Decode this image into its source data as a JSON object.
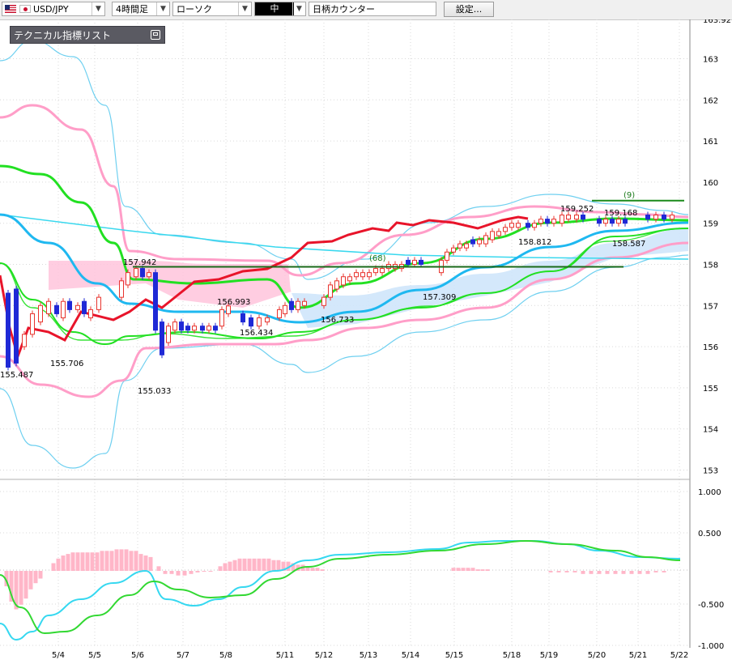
{
  "toolbar": {
    "symbol": "USD/JPY",
    "timeframe": "4時間足",
    "chart_style": "ローソク",
    "size": "中",
    "counter_label": "日柄カウンター",
    "settings_label": "設定..."
  },
  "panel": {
    "tech_list_label": "テクニカル指標リスト"
  },
  "colors": {
    "up_candle": "#e8342e",
    "down_candle": "#1f29d6",
    "ma_red": "#e8142a",
    "ma_green": "#22e022",
    "ma_blue": "#1fb8f0",
    "bollinger_pink": "#ff9ec8",
    "bollinger_blue": "#6fd0f0",
    "macd_line": "#36d8f0",
    "signal_line": "#32d832",
    "histogram": "#ffb6c8"
  },
  "chart_data": [
    {
      "type": "candlestick",
      "ylim": [
        152.8,
        164.0
      ],
      "y_ticks": [
        "153",
        "154",
        "155",
        "156",
        "157",
        "158",
        "159",
        "160",
        "161",
        "162",
        "163",
        "163.92"
      ],
      "x_labels": [
        "5/4",
        "5/5",
        "5/6",
        "5/7",
        "5/8",
        "5/11",
        "5/12",
        "5/13",
        "5/14",
        "5/15",
        "5/18",
        "5/19",
        "5/20",
        "5/21",
        "5/22"
      ],
      "annotations": [
        {
          "text": "155.487",
          "x": "5/1",
          "y": 155.487
        },
        {
          "text": "155.706",
          "x": "5/5",
          "y": 155.706
        },
        {
          "text": "157.942",
          "x": "5/6",
          "y": 157.942
        },
        {
          "text": "155.033",
          "x": "5/6",
          "y": 155.033
        },
        {
          "text": "156.993",
          "x": "5/8",
          "y": 156.993
        },
        {
          "text": "156.434",
          "x": "5/8",
          "y": 156.434
        },
        {
          "text": "156.733",
          "x": "5/12",
          "y": 156.733
        },
        {
          "text": "(68)",
          "x": "5/13",
          "y": 158.2
        },
        {
          "text": "157.309",
          "x": "5/15",
          "y": 157.309
        },
        {
          "text": "158.812",
          "x": "5/19",
          "y": 158.812
        },
        {
          "text": "159.252",
          "x": "5/19",
          "y": 159.252
        },
        {
          "text": "159.168",
          "x": "5/20",
          "y": 159.168
        },
        {
          "text": "(9)",
          "x": "5/21",
          "y": 159.7
        },
        {
          "text": "158.587",
          "x": "5/21",
          "y": 158.587
        }
      ],
      "support_lines": [
        {
          "y": 157.942,
          "from": "5/6",
          "to": "5/21",
          "color": "#1a6a1a"
        },
        {
          "y": 159.55,
          "from": "5/20",
          "to": "5/22",
          "color": "#1a8a1a"
        }
      ]
    },
    {
      "type": "line",
      "ylim": [
        -1.0,
        1.0
      ],
      "y_ticks": [
        "1.000",
        "0.500",
        "-0.500",
        "-1.000"
      ],
      "series": [
        {
          "values": [
            -0.95,
            -0.8,
            -0.55,
            -0.3,
            -0.05,
            0.0,
            -0.3,
            -0.3,
            -0.1,
            0.1,
            0.25,
            0.35,
            0.36,
            0.1
          ]
        },
        {
          "values": [
            -0.1,
            -0.6,
            -0.7,
            -0.5,
            -0.3,
            -0.2,
            -0.25,
            -0.3,
            -0.05,
            0.2,
            0.3,
            0.32,
            0.25,
            0.1
          ]
        }
      ]
    }
  ]
}
